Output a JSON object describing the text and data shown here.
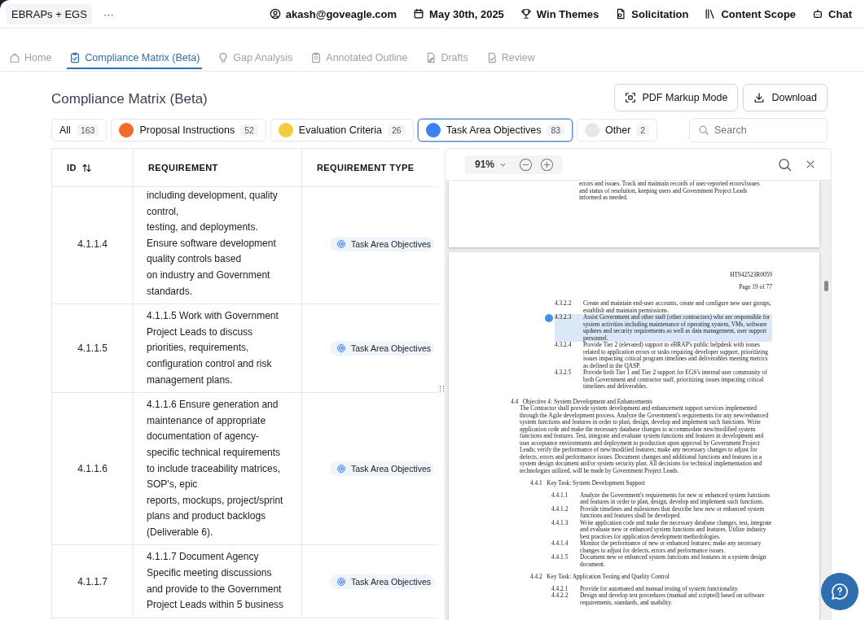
{
  "topbar": {
    "workspace": "EBRAPs + EGS",
    "more": "···",
    "items": [
      {
        "kind": "user",
        "label": "akash@goveagle.com"
      },
      {
        "kind": "calendar",
        "label": "May 30th, 2025"
      },
      {
        "kind": "trophy",
        "label": "Win Themes"
      },
      {
        "kind": "document",
        "label": "Solicitation"
      },
      {
        "kind": "books",
        "label": "Content Scope"
      },
      {
        "kind": "robot",
        "label": "Chat"
      }
    ]
  },
  "tabs": [
    {
      "kind": "home",
      "label": "Home",
      "selected": false
    },
    {
      "kind": "clipboard",
      "label": "Compliance Matrix (Beta)",
      "selected": true
    },
    {
      "kind": "bulb",
      "label": "Gap Analysis",
      "selected": false
    },
    {
      "kind": "outline",
      "label": "Annotated Outline",
      "selected": false
    },
    {
      "kind": "pen",
      "label": "Drafts",
      "selected": false
    },
    {
      "kind": "review",
      "label": "Review",
      "selected": false
    }
  ],
  "page_title": "Compliance Matrix (Beta)",
  "actions": [
    {
      "kind": "markup",
      "label": "PDF Markup Mode"
    },
    {
      "kind": "download",
      "label": "Download"
    }
  ],
  "filters": [
    {
      "label": "All",
      "count": "163",
      "selected": false
    },
    {
      "label": "Proposal Instructions",
      "count": "52",
      "selected": false,
      "color": "#f26b2a"
    },
    {
      "label": "Evaluation Criteria",
      "count": "26",
      "selected": false,
      "color": "#f5cb3c"
    },
    {
      "label": "Task Area Objectives",
      "count": "83",
      "selected": true,
      "color": "#3b82f6"
    },
    {
      "label": "Other",
      "count": "2",
      "selected": false,
      "color": "#e5e7eb"
    }
  ],
  "search": {
    "placeholder": "Search"
  },
  "table": {
    "columns": [
      "ID",
      "REQUIREMENT",
      "REQUIREMENT TYPE"
    ],
    "rows": [
      {
        "id": "4.1.1.4",
        "requirement": [
          "including development, quality",
          "control,",
          "testing, and deployments.",
          "Ensure software development",
          "quality controls based",
          "on industry and Government",
          "standards."
        ],
        "type": "Task Area Objectives"
      },
      {
        "id": "4.1.1.5",
        "requirement": [
          "4.1.1.5 Work with Government",
          "Project Leads to discuss",
          "priorities, requirements,",
          "configuration control and risk",
          "management plans."
        ],
        "type": "Task Area Objectives"
      },
      {
        "id": "4.1.1.6",
        "requirement": [
          "4.1.1.6 Ensure generation and",
          "maintenance of appropriate",
          "documentation of agency-",
          "specific technical requirements",
          "to include traceability matrices,",
          "SOP's, epic",
          "reports, mockups, project/sprint",
          "plans and product backlogs",
          "(Deliverable 6)."
        ],
        "type": "Task Area Objectives"
      },
      {
        "id": "4.1.1.7",
        "requirement": [
          "4.1.1.7 Document Agency",
          "Specific meeting discussions",
          "and provide to the Government",
          "Project Leads within 5 business"
        ],
        "type": "Task Area Objectives"
      }
    ]
  },
  "pdf": {
    "zoom": "91%",
    "previous_page_text": "errors and issues. Track and maintain records of user-reported errors/issues and status of resolution, keeping users and Government Project Leads informed as needed.",
    "doc_number": "HT942523R0059",
    "page_label": "Page 19 of 77",
    "items": [
      {
        "number": "4.3.2.2",
        "text": "Create and maintain end-user accounts, create and configure new user groups, establish and maintain permissions.",
        "highlighted": false
      },
      {
        "number": "4.3.2.3",
        "text": "Assist Government and other staff (other contractors) who are responsible for system activities  including maintenance of operating system, VMs, software updates and security requirements as well as data management, user support personnel.",
        "highlighted": true
      },
      {
        "number": "4.3.2.4",
        "text": "Provide Tier 2 (elevated) support to eBRAP's public helpdesk with issues related to application errors or tasks requiring developer support, prioritizing issues impacting critical program timelines and deliverables meeting metrics as defined in the QASP.",
        "highlighted": false
      },
      {
        "number": "4.3.2.5",
        "text": "Provide both Tier 1 and Tier 2 support for EGS's internal user community of both Government and contractor staff, prioritizing issues impacting critical timelines and deliverables.",
        "highlighted": false
      }
    ],
    "sections": [
      {
        "number": "4.4",
        "title": "Objective 4: System Development and Enhancements",
        "text": "The Contractor shall provide system development and enhancement support services implemented through the Agile development process. Analyze the Government's requirements for any new/enhanced system functions and features in order to plan, design, develop and implement such functions. Write application code and make the necessary database changes to accommodate new/modified system functions and features. Test, integrate and evaluate system functions and features in development and user acceptance environments and deployment to production upon approval by Government Project Leads; verify the performance of new/modified features; make any necessary changes to adjust for defects, errors and performance issues. Document changes and additional functions and features in a system design document and/or system security plan. All decisions for technical implementation and technologies utilized, will be made by Government Project Leads.",
        "children": [
          {
            "number": "4.4.1",
            "title": "Key Task: System Development Support",
            "children": [
              {
                "number": "4.4.1.1",
                "text": "Analyze the Government's requirements for new or enhanced system functions and features in order to plan, design, develop and implement such functions."
              },
              {
                "number": "4.4.1.2",
                "text": "Provide timelines and milestones that describe how new or enhanced system functions and features shall be developed."
              },
              {
                "number": "4.4.1.3",
                "text": "Write application code and make the necessary database changes, test, integrate and evaluate new or enhanced system functions and features. Utilize industry best practices for application development methodologies."
              },
              {
                "number": "4.4.1.4",
                "text": "Monitor the performance of new or enhanced features; make any necessary changes to adjust for defects, errors and performance issues."
              },
              {
                "number": "4.4.1.5",
                "text": "Document new or enhanced system functions and features in a system design document."
              }
            ]
          },
          {
            "number": "4.4.2",
            "title": "Key Task: Application Testing and Quality Control",
            "children": [
              {
                "number": "4.4.2.1",
                "text": "Provide for automated and manual testing of system functionality."
              },
              {
                "number": "4.4.2.2",
                "text": "Design and develop test procedures (manual and scripted) based on software requirements, standards, and usability."
              }
            ]
          }
        ]
      }
    ]
  }
}
